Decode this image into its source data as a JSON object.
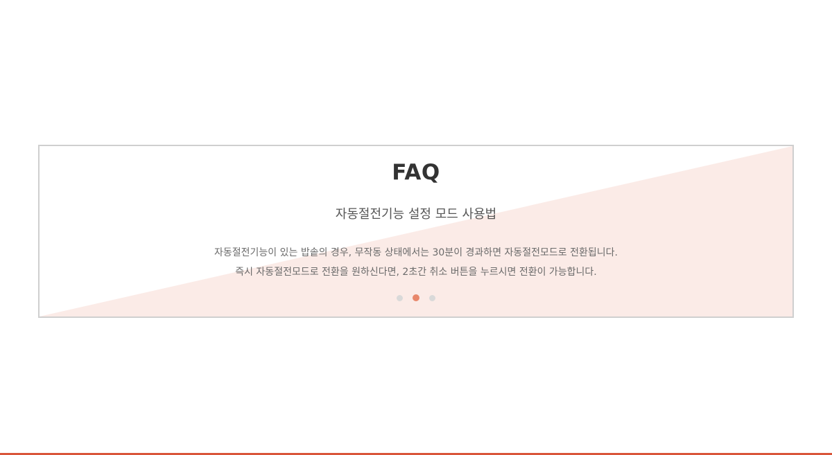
{
  "faq": {
    "title": "FAQ",
    "subtitle": "자동절전기능 설정 모드 사용법",
    "lines": [
      "자동절전기능이 있는 밥솥의 경우, 무작동 상태에서는 30분이 경과하면 자동절전모드로 전환됩니다.",
      "즉시 자동절전모드로 전환을 원하신다면, 2초간 취소 버튼을 누르시면 전환이 가능합니다."
    ],
    "pager": {
      "total": 3,
      "active_index": 1
    }
  },
  "colors": {
    "accent": "#e8876b",
    "diagonal_fill": "#fbebe7",
    "bottom_bar": "#d9553a",
    "border": "#cfcfcf"
  }
}
